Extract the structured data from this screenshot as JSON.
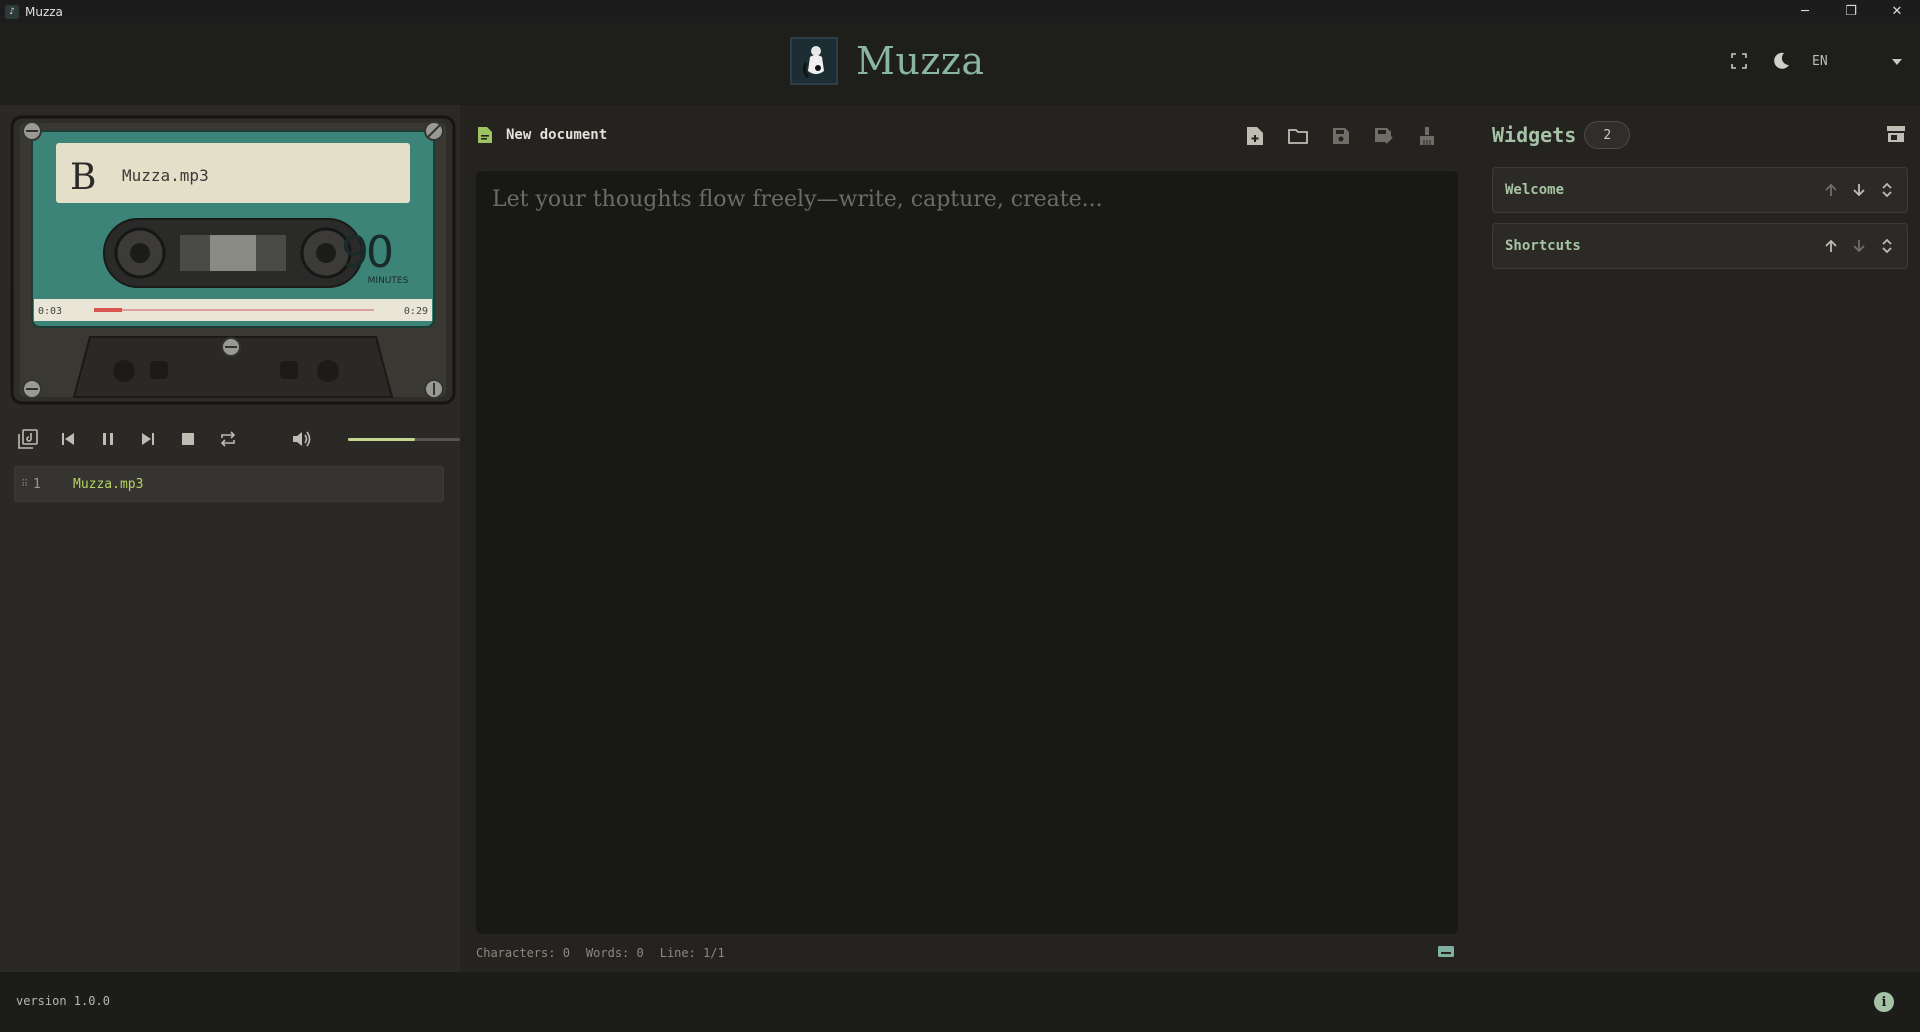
{
  "window": {
    "title": "Muzza",
    "minimize": "─",
    "maximize": "❐",
    "close": "✕"
  },
  "header": {
    "app_name": "Muzza",
    "language": "EN",
    "icons": [
      "fullscreen-icon",
      "moon-icon",
      "chevron-down-icon"
    ]
  },
  "player": {
    "cassette": {
      "side": "B",
      "label": "Muzza.mp3",
      "length_number": "90",
      "length_unit": "MINUTES",
      "time_current": "0:03",
      "time_total": "0:29",
      "progress": 0.1
    },
    "volume": 0.6,
    "playlist": [
      {
        "number": "1",
        "name": "Muzza.mp3"
      }
    ]
  },
  "editor": {
    "doc_title": "New document",
    "placeholder": "Let your thoughts flow freely—write, capture, create...",
    "status": {
      "characters": "Characters: 0",
      "words": "Words: 0",
      "line": "Line: 1/1"
    }
  },
  "widgets": {
    "title": "Widgets",
    "count": "2",
    "items": [
      {
        "name": "Welcome"
      },
      {
        "name": "Shortcuts"
      }
    ]
  },
  "footer": {
    "version": "version 1.0.0",
    "info": "i"
  },
  "colors": {
    "accent": "#8ab5a1",
    "playlist_active": "#b8d264",
    "cassette_teal": "#3c8478",
    "progress_red": "#d9534f"
  }
}
